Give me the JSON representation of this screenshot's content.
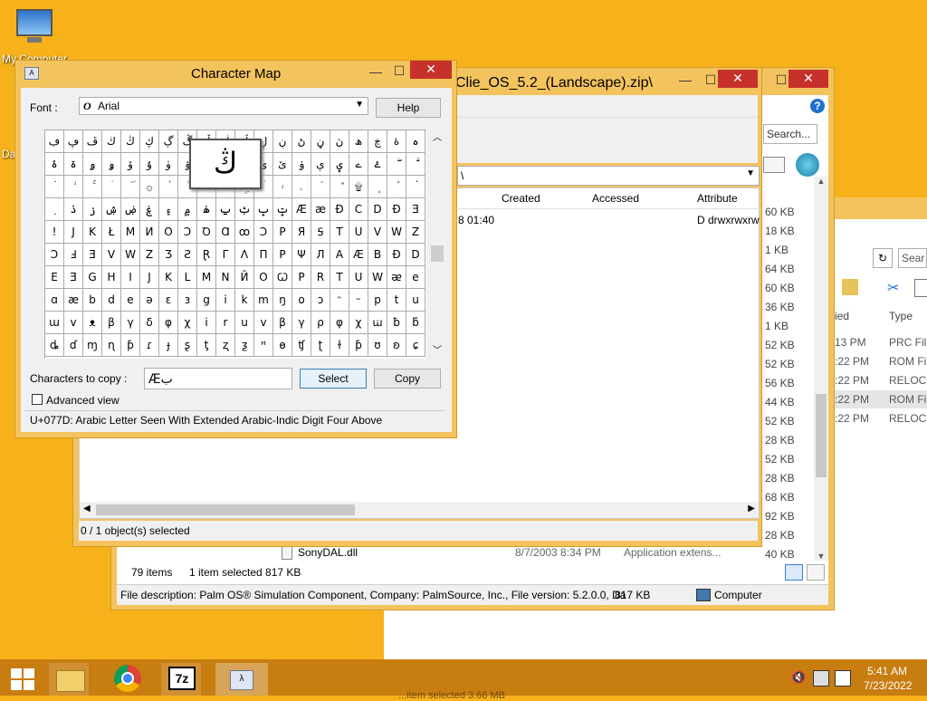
{
  "desktop": {
    "icon1_label": "My Computer",
    "icon2_label": "Da"
  },
  "charmap": {
    "title": "Character Map",
    "font_label": "Font :",
    "font_value": "Arial",
    "help_label": "Help",
    "enlarged_char": "ڭ",
    "rows": [
      [
        "ڢ",
        "ڥ",
        "ڦ",
        "ڬ",
        "ڭ",
        "ڮ",
        "ڳ",
        "ڴ",
        "ڵ",
        "ڶ",
        "ڷ",
        "ڸ",
        "ڹ",
        "ڻ",
        "ڼ",
        "ڽ",
        "ھ",
        "ڿ",
        "ۀ",
        "ہ"
      ],
      [
        "ۂ",
        "ۃ",
        "ۄ",
        "ۅ",
        "ۆ",
        "ۇ",
        "ۈ",
        "ۉ",
        "ۊ",
        "ۋ",
        "ی",
        "ۍ",
        "ێ",
        "ۏ",
        "ې",
        "ۑ",
        "ے",
        "ۓ",
        "ۖ",
        "ۗ"
      ],
      [
        "ۘ",
        "ۙ",
        "ۚ",
        "ۛ",
        "ۜ",
        "۞",
        "۟",
        "۠",
        "ۡ",
        "ۢ",
        "ۣ",
        "ۤ",
        "ۥ",
        "ۦ",
        "ۧ",
        "ۨ",
        "۩",
        "۪",
        "۫",
        "۬"
      ],
      [
        "ۭ",
        "ۮ",
        "ۯ",
        "ۺ",
        "ۻ",
        "ۼ",
        "۽",
        "۾",
        "ۿ",
        "ݐ",
        "ݑ",
        "ݒ",
        "ݓ",
        "Æ",
        "æ",
        "Ð",
        "C",
        "D",
        "Ð",
        "Ǝ"
      ],
      [
        "!",
        "J",
        "K",
        "Ł",
        "M",
        "И",
        "O",
        "Ͻ",
        "Ꝺ",
        "Ɑ",
        "ꝏ",
        "Ͻ",
        "P",
        "Я",
        "Ꟊ",
        "T",
        "U",
        "V",
        "W",
        "Z"
      ],
      [
        "Ↄ",
        "Ⅎ",
        "Ǝ",
        "V",
        "W",
        "Z",
        "Ʒ",
        "Ƨ",
        "Ɽ",
        "Γ",
        "Λ",
        "Π",
        "Ρ",
        "Ψ",
        "Л",
        "A",
        "Æ",
        "B",
        "Ð",
        "D"
      ],
      [
        "E",
        "Ǝ",
        "G",
        "H",
        "I",
        "J",
        "K",
        "L",
        "M",
        "N",
        "Ӣ",
        "O",
        "Ꞷ",
        "P",
        "R",
        "T",
        "U",
        "W",
        "ᴂ",
        "e"
      ],
      [
        "ɑ",
        "æ",
        "b",
        "d",
        "e",
        "ǝ",
        "ɛ",
        "ɜ",
        "g",
        "i",
        "k",
        "m",
        "ŋ",
        "o",
        "ɔ",
        "ᵔ",
        "ᵕ",
        "p",
        "t",
        "u"
      ],
      [
        "ɯ",
        "v",
        "ᴥ",
        "β",
        "γ",
        "δ",
        "φ",
        "χ",
        "i",
        "r",
        "u",
        "v",
        "β",
        "γ",
        "ρ",
        "φ",
        "χ",
        "ꭐ",
        "ƀ",
        "ƃ"
      ],
      [
        "ȡ",
        "ɗ",
        "ɱ",
        "ɳ",
        "ƥ",
        "ɾ",
        "ɟ",
        "ʂ",
        "ƫ",
        "ʐ",
        "ƺ",
        "ᴴ",
        "ɵ",
        "ʧ",
        "ʈ",
        "ɫ",
        "ƥ",
        "ʊ",
        "ʚ",
        "ɕ"
      ]
    ],
    "copy_label": "Characters to copy :",
    "copy_value": "Æب",
    "select_label": "Select",
    "copy_button": "Copy",
    "advanced_label": "Advanced view",
    "status": "U+077D: Arabic Letter Seen With Extended Arabic-Indic Digit Four Above"
  },
  "sevenzip": {
    "title": "Clie_OS_5.2_(Landscape).zip\\",
    "path_value": "\\",
    "columns": [
      "Created",
      "Accessed",
      "Attribute"
    ],
    "row_created": "8 01:40",
    "row_attr": "D drwxrwxrw",
    "status": "0 / 1 object(s) selected"
  },
  "explorer": {
    "search_placeholder": "Search...",
    "search2_placeholder": "Sear",
    "col_modified": "ied",
    "col_type": "Type",
    "sizes": [
      "60 KB",
      "18 KB",
      "1 KB",
      "64 KB",
      "60 KB",
      "36 KB",
      "1 KB",
      "52 KB",
      "52 KB",
      "56 KB",
      "44 KB",
      "52 KB",
      "28 KB",
      "52 KB",
      "28 KB",
      "68 KB",
      "92 KB",
      "28 KB",
      "40 KB"
    ],
    "right_rows": [
      {
        "time": "13 PM",
        "type": "PRC File"
      },
      {
        "time": ":22 PM",
        "type": "ROM Fil"
      },
      {
        "time": ":22 PM",
        "type": "RELOC F"
      },
      {
        "time": ":22 PM",
        "type": "ROM Fil"
      },
      {
        "time": ":22 PM",
        "type": "RELOC F"
      }
    ],
    "last_file_name": "SonyDAL.dll",
    "last_file_date": "8/7/2003 8:34 PM",
    "last_file_type": "Application extens...",
    "item_count": "79 items",
    "selected_info": "1 item selected  817 KB",
    "file_description": "File description: Palm OS® Simulation Component, Company: PalmSource, Inc., File version: 5.2.0.0, Da",
    "file_size": "817 KB",
    "computer_label": "Computer"
  },
  "taskbar": {
    "time": "5:41 AM",
    "date": "7/23/2022",
    "behind_text": "...item selected 3.66 MB"
  },
  "colors": {
    "desktop": "#f7b21b",
    "taskbar": "#c87d10",
    "charmap_frame": "#f3c35e",
    "close_red": "#c7312b"
  }
}
